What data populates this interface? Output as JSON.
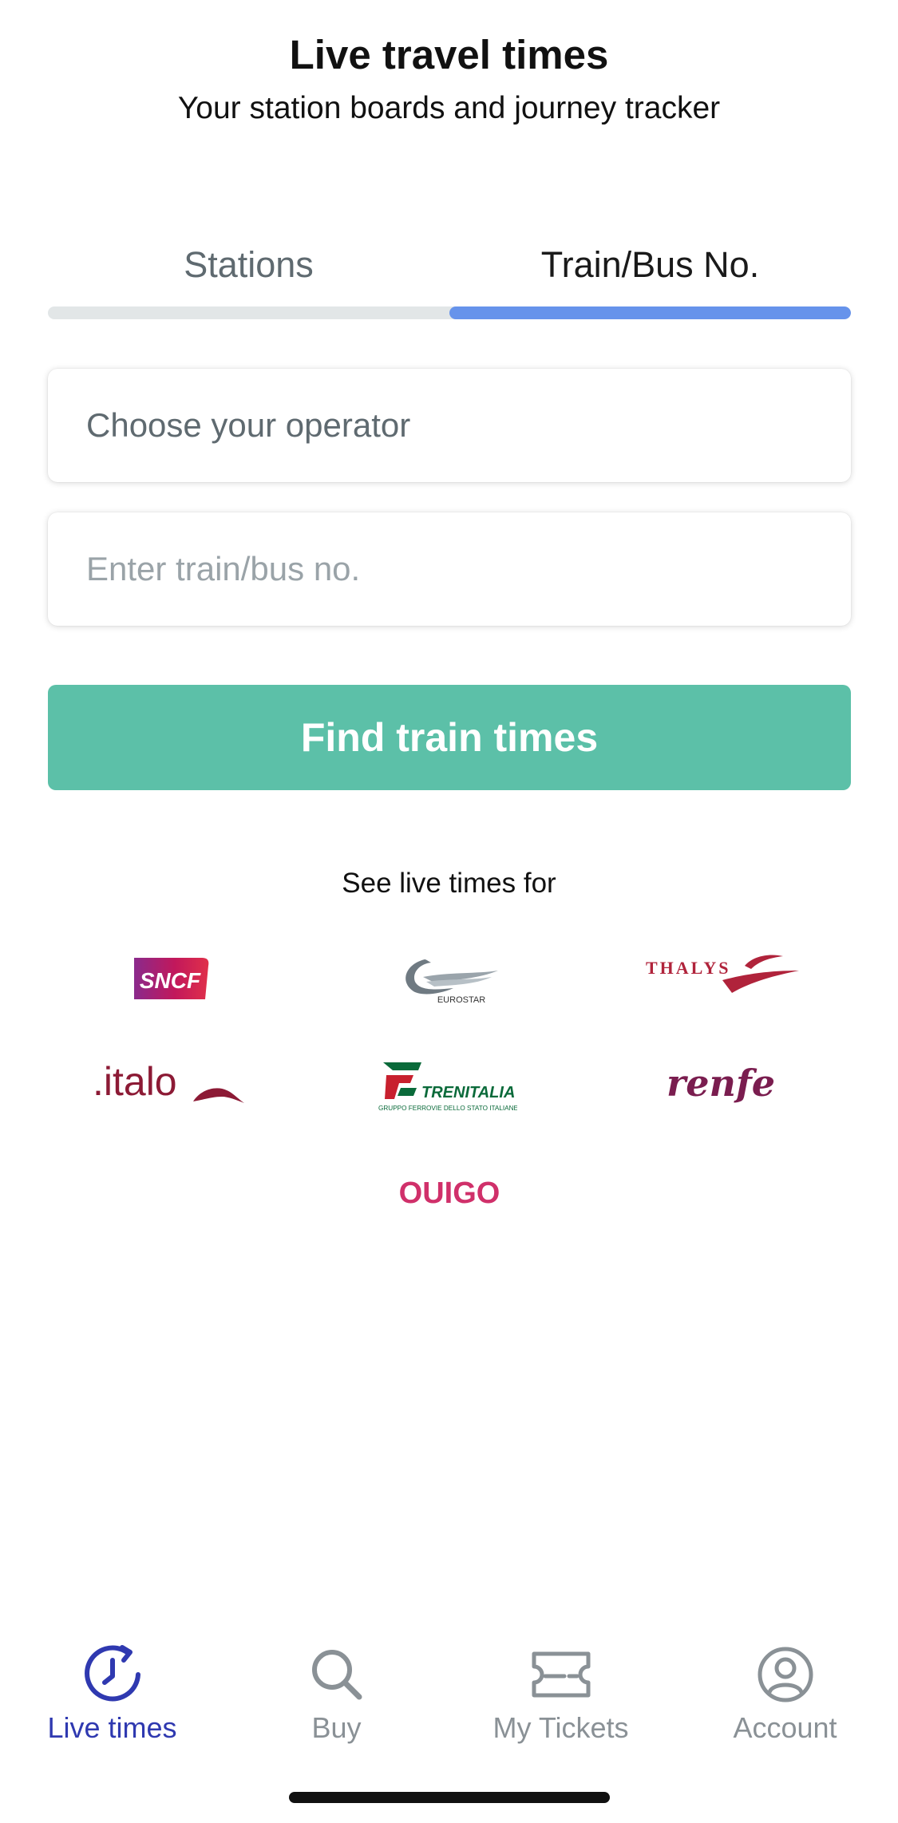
{
  "header": {
    "title": "Live travel times",
    "subtitle": "Your station boards and journey tracker"
  },
  "tabs": {
    "items": [
      {
        "label": "Stations",
        "active": false
      },
      {
        "label": "Train/Bus No.",
        "active": true
      }
    ]
  },
  "form": {
    "operator_placeholder": "Choose your operator",
    "number_placeholder": "Enter train/bus no.",
    "number_value": "",
    "submit_label": "Find train times"
  },
  "operators": {
    "heading": "See live times for",
    "items": [
      {
        "name": "SNCF",
        "logo_text": "SNCF"
      },
      {
        "name": "Eurostar",
        "logo_text": "EUROSTAR"
      },
      {
        "name": "Thalys",
        "logo_text": "THALYS"
      },
      {
        "name": "Italo",
        "logo_text": ".italo"
      },
      {
        "name": "Trenitalia",
        "logo_text": "TRENITALIA",
        "logo_subtext": "GRUPPO FERROVIE DELLO STATO ITALIANE"
      },
      {
        "name": "Renfe",
        "logo_text": "renfe"
      },
      {
        "name": "Ouigo",
        "logo_text": "OUIGO"
      }
    ]
  },
  "bottom_nav": {
    "items": [
      {
        "label": "Live times",
        "icon": "clock-icon",
        "active": true
      },
      {
        "label": "Buy",
        "icon": "search-icon",
        "active": false
      },
      {
        "label": "My Tickets",
        "icon": "ticket-icon",
        "active": false
      },
      {
        "label": "Account",
        "icon": "account-icon",
        "active": false
      }
    ]
  },
  "colors": {
    "accent_tab": "#6693eb",
    "button": "#5cc0a8",
    "nav_active": "#2f39b0",
    "nav_inactive": "#8a9196",
    "thalys": "#b0233b",
    "italo": "#8c1a35",
    "trenitalia": "#0a6a3a",
    "renfe": "#7a1d4f",
    "ouigo": "#d0306a"
  }
}
